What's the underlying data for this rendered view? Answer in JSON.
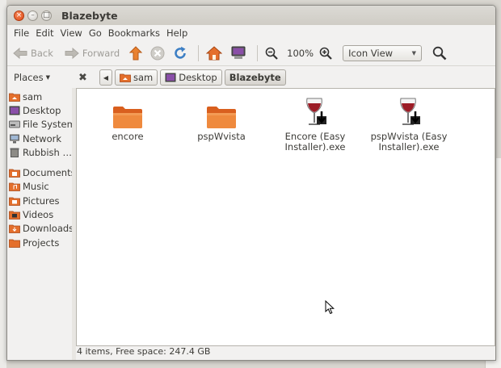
{
  "window": {
    "title": "Blazebyte",
    "buttons": {
      "close": "×",
      "minimize": "–",
      "maximize": "□"
    }
  },
  "menubar": [
    "File",
    "Edit",
    "View",
    "Go",
    "Bookmarks",
    "Help"
  ],
  "toolbar": {
    "back_label": "Back",
    "forward_label": "Forward",
    "zoom": "100%",
    "view_mode": "Icon View"
  },
  "location": {
    "places_label": "Places",
    "crumbs": [
      "sam",
      "Desktop",
      "Blazebyte"
    ]
  },
  "sidebar": {
    "items": [
      {
        "label": "sam",
        "icon": "home-folder-icon"
      },
      {
        "label": "Desktop",
        "icon": "desktop-icon"
      },
      {
        "label": "File System",
        "icon": "harddisk-icon"
      },
      {
        "label": "Network",
        "icon": "network-icon"
      },
      {
        "label": "Rubbish …",
        "icon": "trash-icon"
      },
      {
        "label": "Documents",
        "icon": "documents-folder-icon"
      },
      {
        "label": "Music",
        "icon": "music-folder-icon"
      },
      {
        "label": "Pictures",
        "icon": "pictures-folder-icon"
      },
      {
        "label": "Videos",
        "icon": "videos-folder-icon"
      },
      {
        "label": "Downloads",
        "icon": "downloads-folder-icon"
      },
      {
        "label": "Projects",
        "icon": "folder-icon"
      }
    ]
  },
  "files": [
    {
      "name": "encore",
      "type": "folder"
    },
    {
      "name": "pspWvista",
      "type": "folder"
    },
    {
      "name": "Encore (Easy Installer).exe",
      "type": "wine-exe"
    },
    {
      "name": "pspWvista (Easy Installer).exe",
      "type": "wine-exe"
    }
  ],
  "status": "4 items, Free space: 247.4 GB",
  "colors": {
    "accent": "#dd4814",
    "folder": "#e46f2c"
  }
}
